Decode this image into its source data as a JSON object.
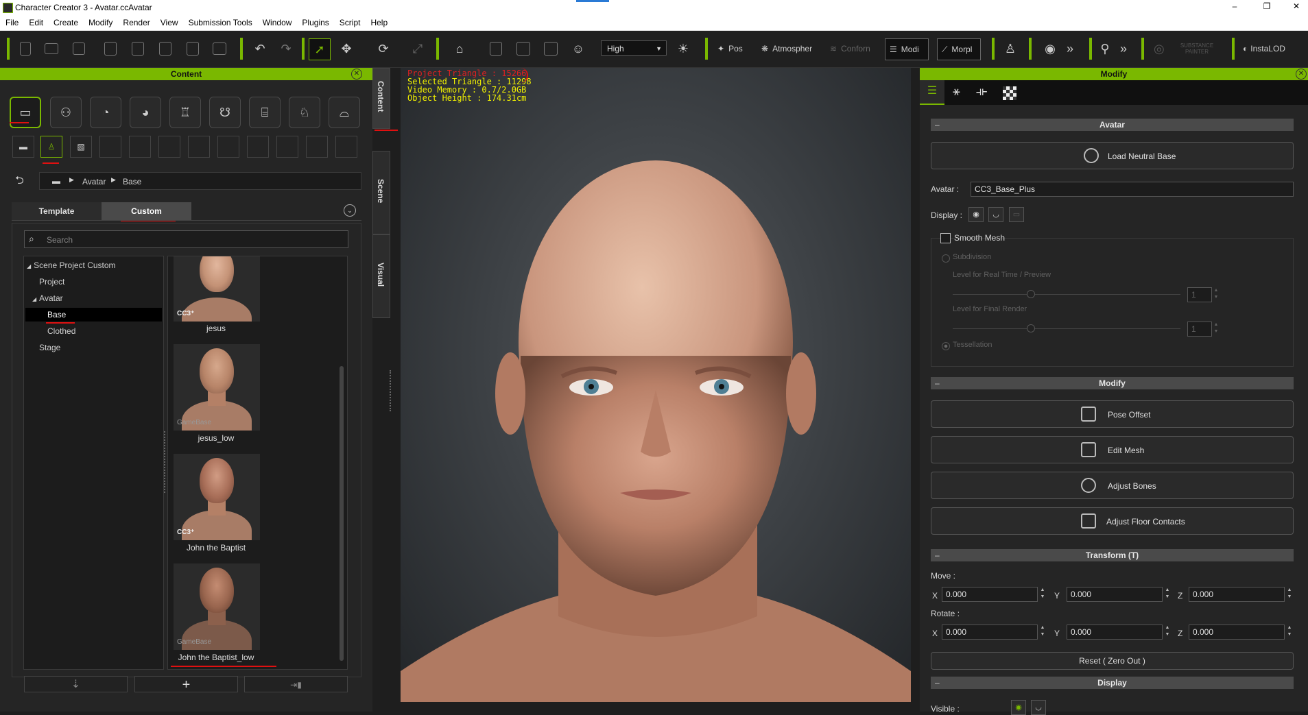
{
  "window": {
    "title": "Character Creator 3 - Avatar.ccAvatar",
    "min_glyph": "–",
    "restore_glyph": "❐",
    "close_glyph": "✕"
  },
  "menu": [
    "File",
    "Edit",
    "Create",
    "Modify",
    "Render",
    "View",
    "Submission Tools",
    "Window",
    "Plugins",
    "Script",
    "Help"
  ],
  "toolbar": {
    "quality": "High",
    "pose": "Pos",
    "atmosphere": "Atmospher",
    "conform": "Conforn",
    "modify": "Modi",
    "morph": "Morpl",
    "substance": "SUBSTANCE PAINTER",
    "instalod": "InstaLOD",
    "more1": "»",
    "more2": "»",
    "accent": "#7ab800"
  },
  "content_panel": {
    "title": "Content",
    "close": "✕",
    "breadcrumb": [
      "Avatar",
      "Base"
    ],
    "tabs": [
      "Template",
      "Custom"
    ],
    "active_tab": "Custom",
    "search_placeholder": "Search",
    "tree": {
      "root": "Scene Project Custom",
      "items": [
        "Project",
        "Avatar",
        "Base",
        "Clothed",
        "Stage"
      ],
      "selected": "Base"
    },
    "items": [
      {
        "label": "jesus",
        "badge": "CC3⁺"
      },
      {
        "label": "jesus_low",
        "badge": "GameBase"
      },
      {
        "label": "John the Baptist",
        "badge": "CC3⁺"
      },
      {
        "label": "John the Baptist_low",
        "badge": "GameBase"
      }
    ],
    "add_button": "+"
  },
  "side_tabs": [
    "Content",
    "Scene",
    "Visual"
  ],
  "viewport": {
    "project_triangle": "Project Triangle : 15266",
    "selected_triangle": "Selected Triangle : 11298",
    "video_memory": "Video Memory : 0.7/2.0GB",
    "object_height": "Object Height : 174.31cm"
  },
  "modify_panel": {
    "title": "Modify",
    "close": "✕",
    "avatar_section": "Avatar",
    "load_neutral": "Load Neutral Base",
    "avatar_label": "Avatar :",
    "avatar_value": "CC3_Base_Plus",
    "display_label": "Display :",
    "smooth_mesh": "Smooth Mesh",
    "subdivision": "Subdivision",
    "level_realtime": "Level for Real Time / Preview",
    "level_final": "Level for Final Render",
    "level_value1": "1",
    "level_value2": "1",
    "tessellation": "Tessellation",
    "modify_section": "Modify",
    "pose_offset": "Pose Offset",
    "edit_mesh": "Edit Mesh",
    "adjust_bones": "Adjust Bones",
    "adjust_floor": "Adjust Floor Contacts",
    "transform_section": "Transform  (T)",
    "move_label": "Move :",
    "rotate_label": "Rotate :",
    "axis_x": "X",
    "axis_y": "Y",
    "axis_z": "Z",
    "move": {
      "x": "0.000",
      "y": "0.000",
      "z": "0.000"
    },
    "rotate": {
      "x": "0.000",
      "y": "0.000",
      "z": "0.000"
    },
    "reset": "Reset ( Zero Out )",
    "display_section": "Display",
    "visible_label": "Visible :"
  }
}
